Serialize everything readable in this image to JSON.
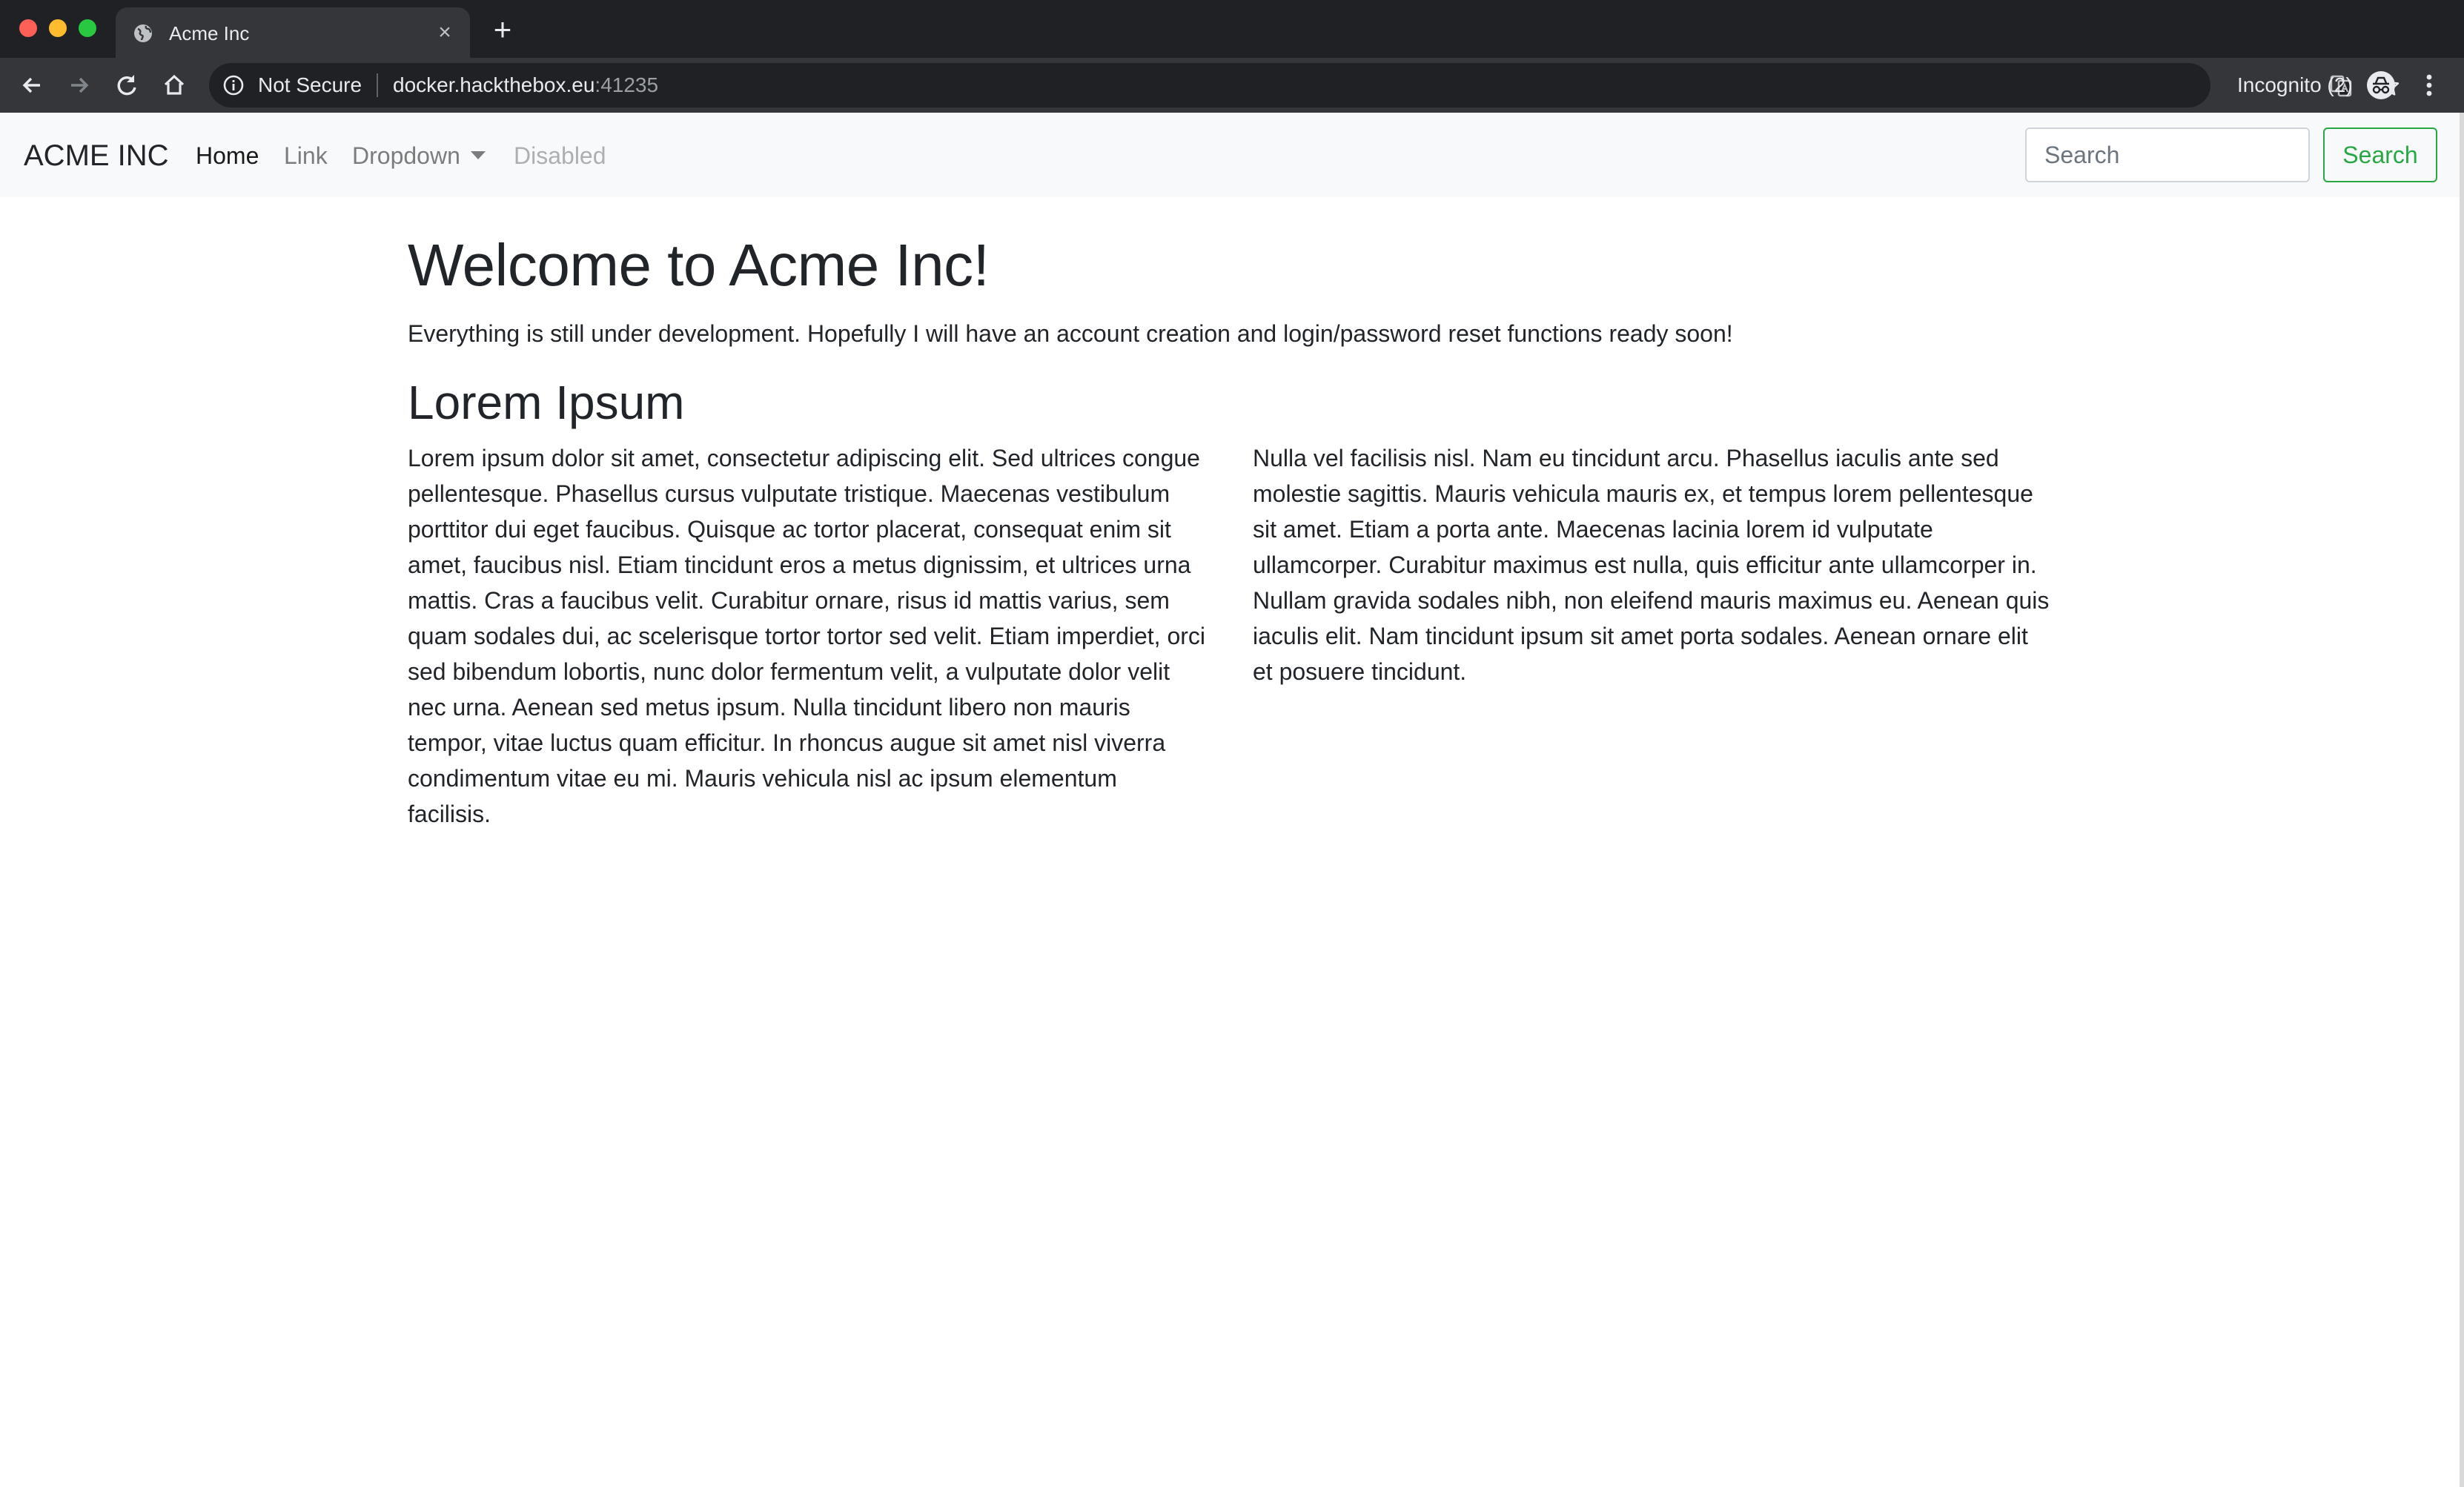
{
  "browser": {
    "tab_title": "Acme Inc",
    "security_label": "Not Secure",
    "url_host": "docker.hackthebox.eu",
    "url_port": ":41235",
    "incognito_label": "Incognito (2)"
  },
  "navbar": {
    "brand": "ACME INC",
    "items": [
      {
        "label": "Home",
        "state": "active"
      },
      {
        "label": "Link",
        "state": "normal"
      },
      {
        "label": "Dropdown",
        "state": "dropdown"
      },
      {
        "label": "Disabled",
        "state": "disabled"
      }
    ],
    "search_placeholder": "Search",
    "search_button": "Search"
  },
  "main": {
    "title": "Welcome to Acme Inc!",
    "lead": "Everything is still under development. Hopefully I will have an account creation and login/password reset functions ready soon!",
    "subtitle": "Lorem Ipsum",
    "paragraphs": [
      "Lorem ipsum dolor sit amet, consectetur adipiscing elit. Sed ultrices congue pellentesque. Phasellus cursus vulputate tristique. Maecenas vestibulum porttitor dui eget faucibus. Quisque ac tortor placerat, consequat enim sit amet, faucibus nisl. Etiam tincidunt eros a metus dignissim, et ultrices urna mattis. Cras a faucibus velit. Curabitur ornare, risus id mattis varius, sem quam sodales dui, ac scelerisque tortor tortor sed velit. Etiam imperdiet, orci sed bibendum lobortis, nunc dolor fermentum velit, a vulputate dolor velit nec urna. Aenean sed metus ipsum. Nulla tincidunt libero non mauris tempor, vitae luctus quam efficitur. In rhoncus augue sit amet nisl viverra condimentum vitae eu mi. Mauris vehicula nisl ac ipsum elementum facilisis.",
      "Nulla vel facilisis nisl. Nam eu tincidunt arcu. Phasellus iaculis ante sed molestie sagittis. Mauris vehicula mauris ex, et tempus lorem pellentesque sit amet. Etiam a porta ante. Maecenas lacinia lorem id vulputate ullamcorper. Curabitur maximus est nulla, quis efficitur ante ullamcorper in. Nullam gravida sodales nibh, non eleifend mauris maximus eu. Aenean quis iaculis elit. Nam tincidunt ipsum sit amet porta sodales. Aenean ornare elit et posuere tincidunt."
    ]
  },
  "icons": {
    "tab_favicon": "globe-icon",
    "back": "back-arrow-icon",
    "forward": "forward-arrow-icon",
    "reload": "reload-icon",
    "home": "home-icon",
    "info": "info-icon",
    "translate": "translate-icon",
    "bookmark": "star-icon",
    "incognito": "incognito-icon",
    "menu": "kebab-menu-icon"
  },
  "colors": {
    "success": "#28a745",
    "navbar_bg": "#f8f9fa",
    "chrome_dark": "#202124"
  }
}
